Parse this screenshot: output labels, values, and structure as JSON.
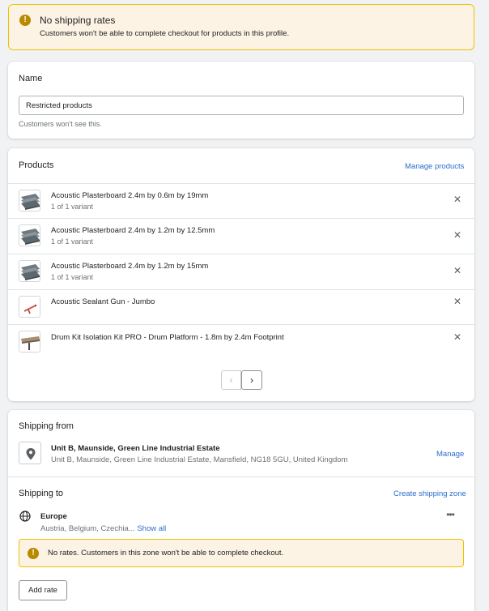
{
  "banner": {
    "icon": "warning-icon",
    "title": "No shipping rates",
    "message": "Customers won't be able to complete checkout for products in this profile."
  },
  "name_card": {
    "label": "Name",
    "value": "Restricted products",
    "help": "Customers won't see this."
  },
  "products_card": {
    "title": "Products",
    "manage_link": "Manage products",
    "items": [
      {
        "name": "Acoustic Plasterboard 2.4m by 0.6m by 19mm",
        "variants": "1 of 1 variant",
        "thumb": "plasterboard"
      },
      {
        "name": "Acoustic Plasterboard 2.4m by 1.2m by 12.5mm",
        "variants": "1 of 1 variant",
        "thumb": "plasterboard"
      },
      {
        "name": "Acoustic Plasterboard 2.4m by 1.2m by 15mm",
        "variants": "1 of 1 variant",
        "thumb": "plasterboard"
      },
      {
        "name": "Acoustic Sealant Gun - Jumbo",
        "variants": "",
        "thumb": "sealant-gun"
      },
      {
        "name": "Drum Kit Isolation Kit PRO - Drum Platform - 1.8m by 2.4m Footprint",
        "variants": "",
        "thumb": "drum-platform"
      }
    ],
    "pagination": {
      "prev": "‹",
      "next": "›"
    }
  },
  "shipping_from": {
    "title": "Shipping from",
    "location_name": "Unit B, Maunside, Green Line Industrial Estate",
    "location_address": "Unit B, Maunside, Green Line Industrial Estate, Mansfield, NG18 5GU, United Kingdom",
    "manage_link": "Manage"
  },
  "shipping_to": {
    "title": "Shipping to",
    "create_link": "Create shipping zone",
    "zone": {
      "name": "Europe",
      "countries": "Austria, Belgium, Czechia...",
      "show_all": "Show all",
      "more": "•••",
      "warning": "No rates. Customers in this zone won't be able to complete checkout."
    },
    "add_rate": "Add rate"
  },
  "colors": {
    "accent": "#2c6ecb",
    "warning_bg": "#fdf3e5",
    "warning_border": "#eec200",
    "warning_icon": "#b98900"
  }
}
